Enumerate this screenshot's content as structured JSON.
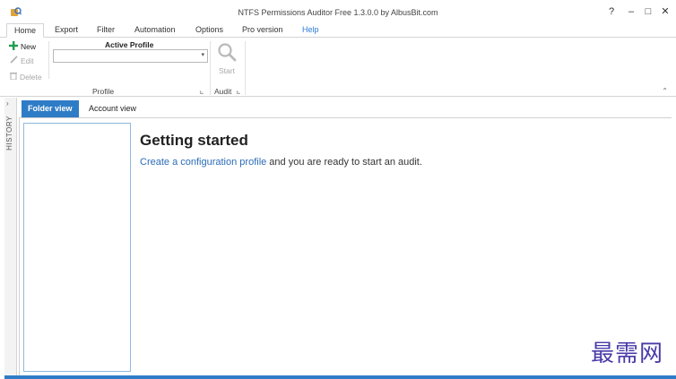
{
  "window": {
    "title": "NTFS Permissions Auditor Free 1.3.0.0 by AlbusBit.com",
    "controls": {
      "help": "?",
      "minimize": "–",
      "maximize": "□",
      "close": "✕"
    }
  },
  "ribbon_tabs": [
    {
      "label": "Home",
      "active": true
    },
    {
      "label": "Export"
    },
    {
      "label": "Filter"
    },
    {
      "label": "Automation"
    },
    {
      "label": "Options"
    },
    {
      "label": "Pro version"
    },
    {
      "label": "Help"
    }
  ],
  "ribbon": {
    "profile_group": {
      "new": "New",
      "edit": "Edit",
      "delete": "Delete",
      "active_profile_label": "Active Profile",
      "active_profile_value": "",
      "group_label": "Profile"
    },
    "audit_group": {
      "start": "Start",
      "group_label": "Audit"
    }
  },
  "sidebar": {
    "history_label": "HISTORY"
  },
  "view_tabs": [
    {
      "label": "Folder view",
      "active": true
    },
    {
      "label": "Account view"
    }
  ],
  "main": {
    "heading": "Getting started",
    "link_text": "Create a configuration profile",
    "trailing_text": " and you are ready to start an audit."
  },
  "watermark": "最需网",
  "colors": {
    "accent": "#2f7cc6",
    "link": "#2b6cb8",
    "help_tab": "#2b7bd6",
    "new_icon": "#1f9e4f"
  }
}
